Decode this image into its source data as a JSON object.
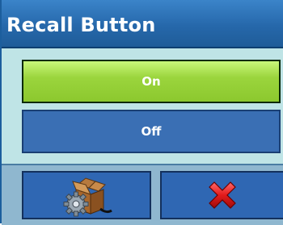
{
  "dialog": {
    "title": "Recall Button"
  },
  "options": [
    {
      "label": "On",
      "selected": true
    },
    {
      "label": "Off",
      "selected": false
    }
  ],
  "softkeys": {
    "left": {
      "icon": "box-settings-icon"
    },
    "right": {
      "icon": "close-x-icon"
    }
  },
  "colors": {
    "title_bar": "#2668ab",
    "background": "#bfe4e6",
    "selected_option": "#9bd53d",
    "unselected_option": "#3a6fb4",
    "softkey": "#2f67b3",
    "close_x": "#d81818"
  }
}
